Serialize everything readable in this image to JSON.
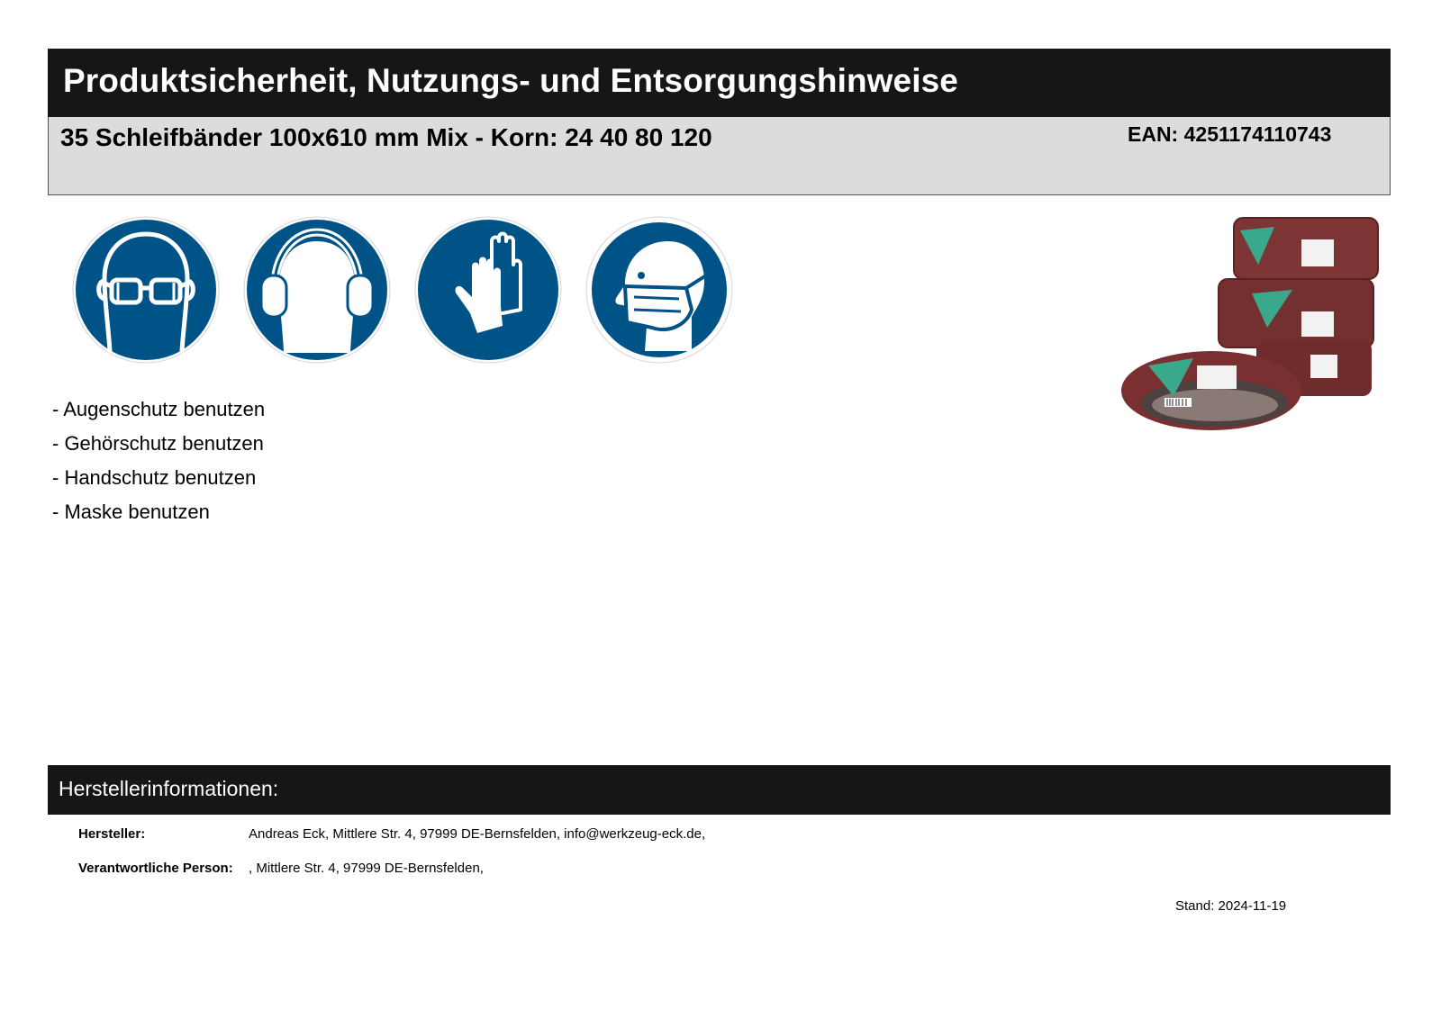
{
  "header": {
    "title": "Produktsicherheit, Nutzungs- und Entsorgungshinweise"
  },
  "product": {
    "name": "35 Schleifbänder 100x610 mm Mix - Korn: 24 40 80 120",
    "ean": "EAN: 4251174110743"
  },
  "safety_icons": [
    "eye-protection-icon",
    "ear-protection-icon",
    "hand-protection-icon",
    "mask-icon"
  ],
  "notes": [
    "- Augenschutz benutzen",
    "- Gehörschutz benutzen",
    "- Handschutz benutzen",
    "- Maske benutzen"
  ],
  "colors": {
    "header_bg": "#161616",
    "product_bar_bg": "#dcdcdc",
    "sign_blue": "#005387",
    "belt_red": "#7a2e2e",
    "label_green": "#3aa88a"
  },
  "manufacturer": {
    "section_title": "Herstellerinformationen:",
    "rows": [
      {
        "key": "Hersteller:",
        "value": "Andreas Eck, Mittlere Str. 4, 97999 DE-Bernsfelden, info@werkzeug-eck.de,"
      },
      {
        "key": "Verantwortliche Person:",
        "value": ", Mittlere Str. 4, 97999 DE-Bernsfelden,"
      }
    ]
  },
  "footer": {
    "stand": "Stand: 2024-11-19"
  }
}
